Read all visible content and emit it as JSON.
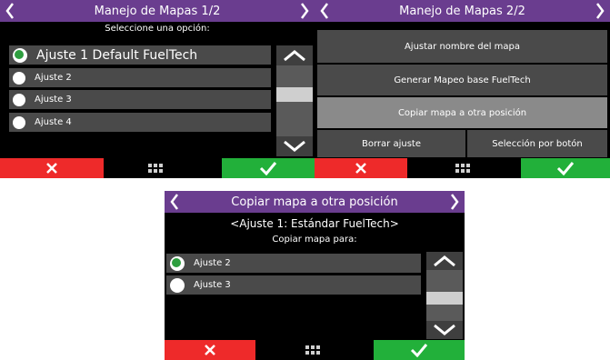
{
  "screen1": {
    "title": "Manejo de Mapas 1/2",
    "subtitle": "Seleccione una opción:",
    "items": [
      {
        "label": "Ajuste 1 Default FuelTech",
        "selected": true
      },
      {
        "label": "Ajuste 2",
        "selected": false
      },
      {
        "label": "Ajuste 3",
        "selected": false
      },
      {
        "label": "Ajuste 4",
        "selected": false
      }
    ]
  },
  "screen2": {
    "title": "Manejo de Mapas 2/2",
    "buttons": {
      "rename": "Ajustar nombre del mapa",
      "generate": "Generar Mapeo base FuelTech",
      "copy": "Copiar mapa a otra posición",
      "delete": "Borrar ajuste",
      "select_by_button": "Selección por botón"
    }
  },
  "screen3": {
    "title": "Copiar mapa a otra posición",
    "source": "<Ajuste 1: Estándar FuelTech>",
    "prompt": "Copiar mapa para:",
    "items": [
      {
        "label": "Ajuste 2",
        "selected": true
      },
      {
        "label": "Ajuste 3",
        "selected": false
      }
    ]
  },
  "icons": {
    "prev": "chevron-left-icon",
    "next": "chevron-right-icon",
    "up": "chevron-up-icon",
    "down": "chevron-down-icon",
    "cancel": "close-icon",
    "menu": "grid-icon",
    "confirm": "check-icon"
  },
  "colors": {
    "titlebar": "#6a3d8f",
    "row": "#4a4a4a",
    "highlight": "#8a8a8a",
    "cancel": "#ee2a2a",
    "confirm": "#22b03a",
    "radio_selected": "#2e9e3f"
  }
}
